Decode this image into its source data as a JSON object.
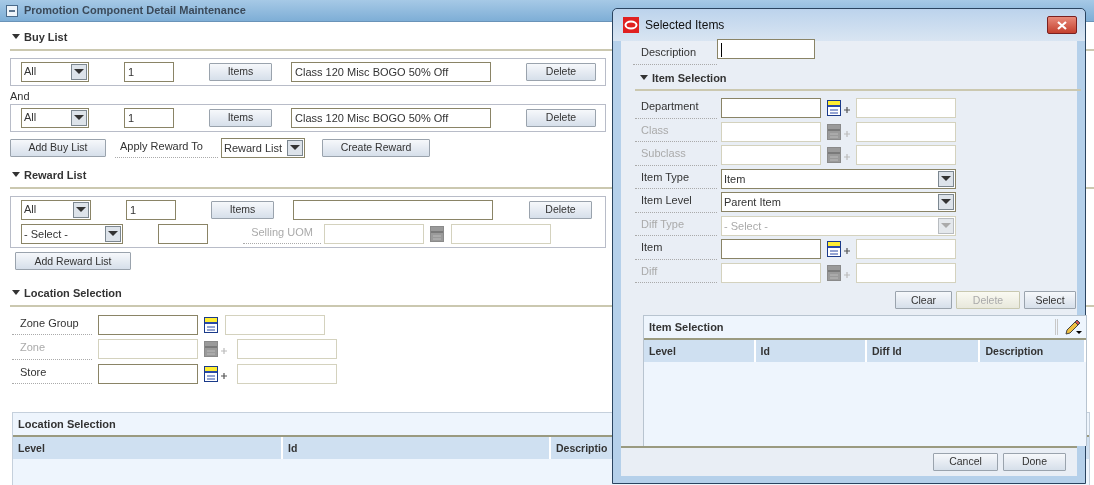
{
  "main": {
    "title": "Promotion Component Detail Maintenance",
    "buy_list": {
      "heading": "Buy List",
      "joiner": "And",
      "rows": [
        {
          "type": "All",
          "quantity": "1",
          "items_button": "Items",
          "description": "Class 120 Misc BOGO 50% Off",
          "delete_button": "Delete"
        },
        {
          "type": "All",
          "quantity": "1",
          "items_button": "Items",
          "description": "Class 120 Misc BOGO 50% Off",
          "delete_button": "Delete"
        }
      ],
      "add_button": "Add Buy List",
      "apply_label": "Apply Reward To",
      "apply_value": "Reward List",
      "create_button": "Create Reward"
    },
    "reward_list": {
      "heading": "Reward List",
      "type": "All",
      "quantity": "1",
      "items_button": "Items",
      "delete_button": "Delete",
      "uom_select": "- Select -",
      "selling_uom_label": "Selling UOM",
      "add_button": "Add Reward List"
    },
    "location_selection": {
      "heading": "Location Selection",
      "fields": [
        {
          "label": "Zone Group",
          "disabled": false,
          "plus": false
        },
        {
          "label": "Zone",
          "disabled": true,
          "plus": true
        },
        {
          "label": "Store",
          "disabled": false,
          "plus": true
        }
      ]
    },
    "location_table": {
      "title": "Location Selection",
      "columns": [
        "Level",
        "Id",
        "Descriptio"
      ]
    }
  },
  "dialog": {
    "title": "Selected Items",
    "description_label": "Description",
    "section_heading": "Item Selection",
    "fields": [
      {
        "kind": "lookup",
        "label": "Department",
        "disabled": false
      },
      {
        "kind": "lookup",
        "label": "Class",
        "disabled": true
      },
      {
        "kind": "lookup",
        "label": "Subclass",
        "disabled": true
      },
      {
        "kind": "select",
        "label": "Item Type",
        "value": "Item",
        "disabled": false
      },
      {
        "kind": "select",
        "label": "Item Level",
        "value": "Parent Item",
        "disabled": false
      },
      {
        "kind": "select",
        "label": "Diff Type",
        "value": "- Select -",
        "disabled": true
      },
      {
        "kind": "lookup",
        "label": "Item",
        "disabled": false
      },
      {
        "kind": "lookup",
        "label": "Diff",
        "disabled": true
      }
    ],
    "buttons": [
      {
        "label": "Clear",
        "disabled": false
      },
      {
        "label": "Delete",
        "disabled": true
      },
      {
        "label": "Select",
        "disabled": false
      }
    ],
    "table": {
      "title": "Item Selection",
      "columns": [
        "Level",
        "Id",
        "Diff Id",
        "Description"
      ]
    },
    "footer_buttons": [
      "Cancel",
      "Done"
    ]
  }
}
